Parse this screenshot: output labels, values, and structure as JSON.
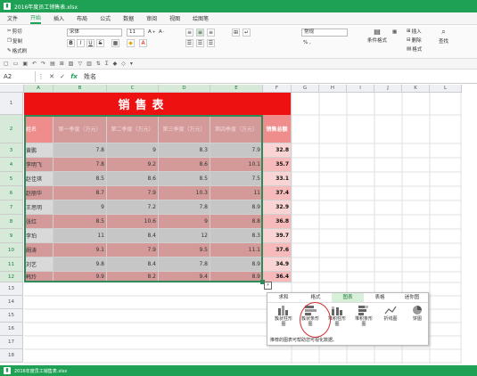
{
  "window": {
    "title": "2016年度员工销售表.xlsx"
  },
  "menu": [
    "文件",
    "开始",
    "插入",
    "布局",
    "公式",
    "数据",
    "审阅",
    "视图",
    "绘图笔"
  ],
  "ribbon": {
    "cut": "剪切",
    "copy": "复制",
    "paste_format": "格式刷",
    "font_name": "宋体",
    "font_size": "11",
    "number_format": "常规",
    "cond_format": "条件格式",
    "insert": "插入",
    "delete": "删除",
    "format": "格式",
    "find": "查找"
  },
  "formula": {
    "cell_ref": "A2",
    "content": "姓名"
  },
  "columns": [
    "A",
    "B",
    "C",
    "D",
    "E",
    "F",
    "G",
    "H",
    "I",
    "J",
    "K",
    "L"
  ],
  "rows": [
    "1",
    "2",
    "3",
    "4",
    "5",
    "6",
    "7",
    "8",
    "9",
    "10",
    "11",
    "12",
    "13",
    "14",
    "15",
    "16",
    "17",
    "18"
  ],
  "table": {
    "title": "销售表",
    "headers": [
      "姓名",
      "第一季度（万元）",
      "第二季度（万元）",
      "第三季度（万元）",
      "第四季度（万元）",
      "销售总额"
    ],
    "data": [
      [
        "黄鹏",
        "7.8",
        "9",
        "8.3",
        "7.9",
        "32.8"
      ],
      [
        "李明飞",
        "7.8",
        "9.2",
        "8.6",
        "10.1",
        "35.7"
      ],
      [
        "赵佳琪",
        "8.5",
        "8.6",
        "8.5",
        "7.5",
        "33.1"
      ],
      [
        "赵丽华",
        "8.7",
        "7.9",
        "10.3",
        "11",
        "37.4"
      ],
      [
        "王思明",
        "9",
        "7.2",
        "7.8",
        "8.9",
        "32.9"
      ],
      [
        "张红",
        "8.5",
        "10.6",
        "9",
        "8.8",
        "36.8"
      ],
      [
        "李珀",
        "11",
        "8.4",
        "12",
        "8.3",
        "39.7"
      ],
      [
        "阚涛",
        "9.1",
        "7.9",
        "9.5",
        "11.1",
        "37.6"
      ],
      [
        "刘艺",
        "9.8",
        "8.4",
        "7.8",
        "8.9",
        "34.9"
      ],
      [
        "韩玲",
        "9.9",
        "8.2",
        "9.4",
        "8.9",
        "36.4"
      ]
    ]
  },
  "quick_analysis": {
    "tabs": [
      "求和",
      "格式",
      "图表",
      "表格",
      "迷你图"
    ],
    "buttons": [
      "簇状柱形图",
      "簇状条形图",
      "堆积柱形图",
      "堆积条形图",
      "折线图",
      "饼图"
    ],
    "hint": "推荐的图表可帮助您可视化数据。"
  },
  "status": {
    "text": "2016年度员工销售表.xlsx"
  },
  "colors": {
    "accent": "#1fa155",
    "title_red": "#ee1111",
    "row_gray": "#c6c6c6",
    "row_pink": "#d49a9a",
    "total_pink": "#f2a3a3"
  }
}
